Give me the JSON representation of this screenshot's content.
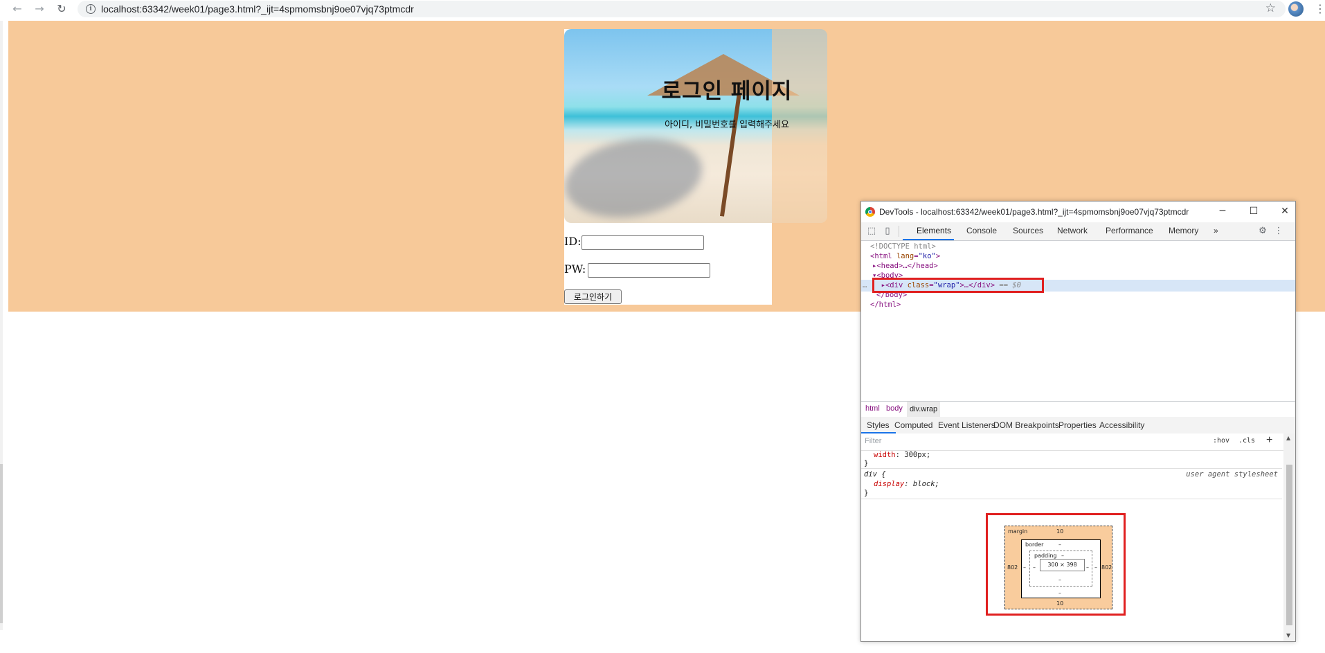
{
  "browser": {
    "url": "localhost:63342/week01/page3.html?_ijt=4spmomsbnj9oe07vjq73ptmcdr",
    "back_icon": "←",
    "forward_icon": "→",
    "reload_icon": "↻",
    "info_icon": "i",
    "star_icon": "☆",
    "menu_icon": "⋮"
  },
  "page": {
    "background_color": "#f7c999",
    "title": "로그인 페이지",
    "subtitle": "아이디, 비밀번호를 입력해주세요",
    "id_label": "ID:",
    "pw_label": "PW:",
    "login_button": "로그인하기"
  },
  "devtools": {
    "window_title": "DevTools - localhost:63342/week01/page3.html?_ijt=4spmomsbnj9oe07vjq73ptmcdr",
    "min_icon": "─",
    "max_icon": "☐",
    "close_icon": "✕",
    "tabs": [
      "Elements",
      "Console",
      "Sources",
      "Network",
      "Performance",
      "Memory"
    ],
    "more_tabs": "»",
    "settings_icon": "⚙",
    "kebab_icon": "⋮",
    "dom": {
      "doctype": "<!DOCTYPE html>",
      "html_open_tag": "<html",
      "html_attr": "lang",
      "html_attr_value": "\"ko\"",
      "head": "<head>…</head>",
      "body_open": "<body>",
      "div_open": "<div",
      "div_attr": "class",
      "div_attr_value": "\"wrap\"",
      "div_rest": ">…</div>",
      "selected_marker": "== $0",
      "gutter_dots": "…",
      "body_close": "</body>",
      "html_close": "</html>"
    },
    "breadcrumbs": [
      "html",
      "body",
      "div.wrap"
    ],
    "sub_tabs": [
      "Styles",
      "Computed",
      "Event Listeners",
      "DOM Breakpoints",
      "Properties",
      "Accessibility"
    ],
    "filter_placeholder": "Filter",
    "hov": ":hov",
    "cls": ".cls",
    "add_rule": "+",
    "styles": {
      "width_prop": "width",
      "width_value": "300px;",
      "close_brace_1": "}",
      "div_selector": "div {",
      "ua_label": "user agent stylesheet",
      "display_prop": "display",
      "display_value": "block;",
      "close_brace_2": "}"
    },
    "box_model": {
      "margin_label": "margin",
      "margin_top": "10",
      "margin_bottom": "10",
      "margin_left": "802",
      "margin_right": "802",
      "border_label": "border",
      "border_top": "–",
      "border_bottom": "–",
      "border_left": "–",
      "border_right": "–",
      "padding_label": "padding",
      "padding_top": "–",
      "padding_bottom": "–",
      "padding_left": "–",
      "padding_right": "–",
      "content_size": "300 × 398"
    }
  }
}
